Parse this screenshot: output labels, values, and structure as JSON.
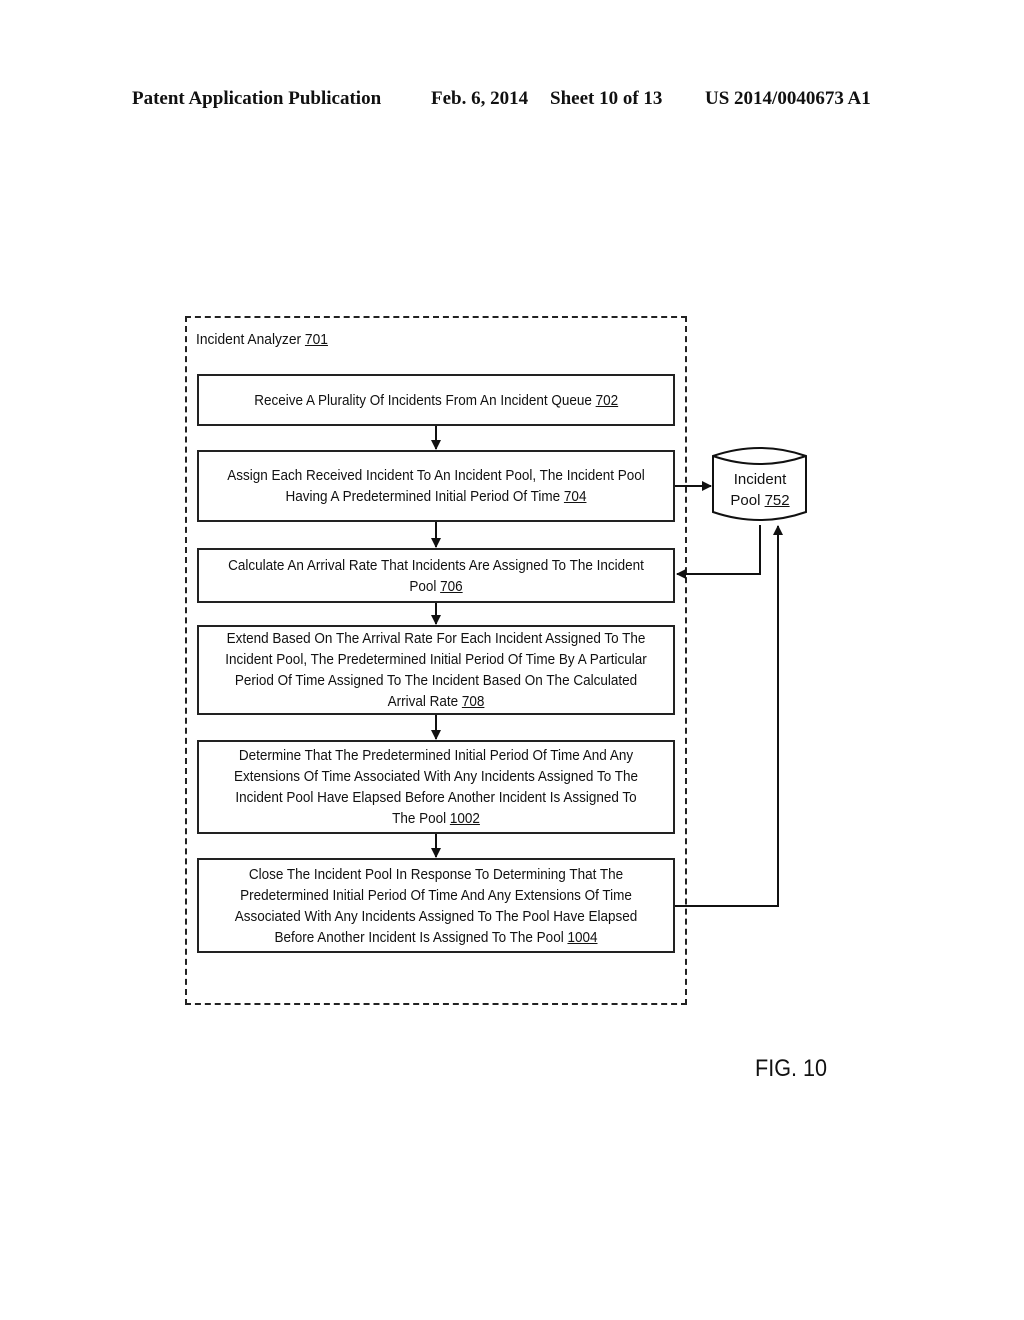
{
  "header": {
    "publication": "Patent Application Publication",
    "date": "Feb. 6, 2014",
    "sheet": "Sheet 10 of 13",
    "number": "US 2014/0040673 A1"
  },
  "diagram": {
    "container": {
      "label": "Incident Analyzer ",
      "ref": "701"
    },
    "steps": [
      {
        "text": "Receive A Plurality Of Incidents From An Incident Queue ",
        "ref": "702"
      },
      {
        "text": "Assign Each Received Incident To An Incident Pool, The Incident Pool Having A Predetermined Initial Period Of Time ",
        "ref": "704"
      },
      {
        "text": "Calculate An Arrival Rate That Incidents Are Assigned To The Incident Pool ",
        "ref": "706"
      },
      {
        "text": "Extend Based On The Arrival Rate For Each Incident Assigned To The Incident Pool, The Predetermined Initial Period Of Time By A Particular Period Of Time Assigned To The Incident Based On The Calculated Arrival Rate ",
        "ref": "708"
      },
      {
        "text": "Determine That The Predetermined Initial Period Of Time And Any Extensions Of Time Associated With Any Incidents Assigned To The Incident Pool Have Elapsed Before Another Incident Is Assigned To The Pool ",
        "ref": "1002"
      },
      {
        "text": "Close The Incident Pool In Response To Determining That The Predetermined Initial Period Of Time And Any Extensions Of Time Associated With Any Incidents Assigned To The Pool Have Elapsed Before Another Incident Is Assigned To The Pool ",
        "ref": "1004"
      }
    ],
    "datastore": {
      "line1": "Incident",
      "line2": "Pool ",
      "ref": "752"
    },
    "connections": [
      {
        "from": "702",
        "to": "704"
      },
      {
        "from": "704",
        "to": "706"
      },
      {
        "from": "706",
        "to": "708"
      },
      {
        "from": "708",
        "to": "1002"
      },
      {
        "from": "1002",
        "to": "1004"
      },
      {
        "from": "704",
        "to": "752"
      },
      {
        "from": "752",
        "to": "706"
      },
      {
        "from": "1004",
        "to": "752"
      }
    ]
  },
  "figure_label": "FIG. 10"
}
